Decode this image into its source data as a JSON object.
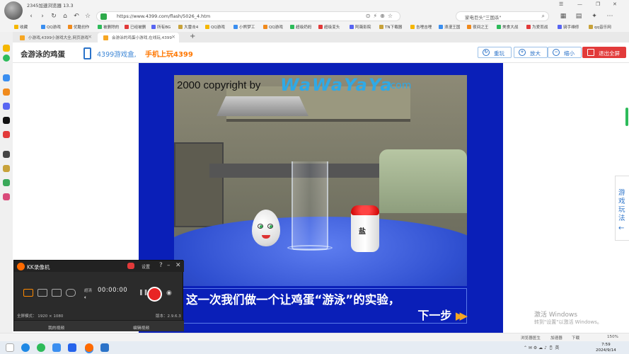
{
  "browser": {
    "window_title": "2345加速浏览器 13.3",
    "window_controls": [
      "☰",
      "—",
      "❐",
      "✕"
    ],
    "url": "https://www.4399.com/flash/5026_4.htm",
    "search_text": "家电巨头\"三国杀\"",
    "bookmarks": [
      "收藏",
      "QQ游戏",
      "优酷创作",
      "被删除的",
      "已经被删",
      "所有BG",
      "大雷击4",
      "QQ游戏",
      "小熊梦工",
      "QQ游戏",
      "超级奶妈",
      "超级变头",
      "阿薇影院",
      "TN下载器",
      "吉哩吉哩",
      "浪漫王国",
      "夜间之王",
      "美食大战",
      "为爱而战",
      "骑手维修",
      "qq音乐网"
    ],
    "tabs": [
      {
        "label": "小游戏,4399小游戏大全,网页游戏",
        "active": false
      },
      {
        "label": "会游泳的鸡蛋小游戏,在线玩,4399",
        "active": true
      }
    ]
  },
  "page": {
    "game_title": "会游泳的鸡蛋",
    "promo_text": "4399游戏盒,",
    "promo_slogan": "手机上玩4399",
    "buttons": {
      "replay": "重玩",
      "zoom_in": "放大",
      "zoom_out": "缩小",
      "exit_fullscreen": "退出全屏"
    },
    "side_tab": "游戏玩法"
  },
  "game": {
    "copyright": "2000 copyright by",
    "logo": "WaWaYaYa",
    "logo_suffix": ".com",
    "salt_label": "盐",
    "subtitle": "这一次我们做一个让鸡蛋“游泳”的实验，",
    "next_label": "下一步"
  },
  "recorder": {
    "name": "KK录像机",
    "settings": "设置",
    "quality": "超清",
    "timer": "00:00:00",
    "mode_label": "全屏模式： 1920 × 1080",
    "version": "版本：2.9.6.3",
    "my_videos": "我的视频",
    "edit_video": "编辑视频"
  },
  "watermark": {
    "line1": "激活 Windows",
    "line2": "转到\"设置\"以激活 Windows。"
  },
  "statusbar": {
    "items": [
      "浏览器医生",
      "加速器",
      "下载",
      "150%"
    ]
  },
  "taskbar": {
    "time": "7:59",
    "date": "2024/9/14"
  },
  "colors": {
    "stage_blue": "#0a1fb8",
    "accent_blue": "#2b73c9",
    "exit_red": "#e23a3a",
    "promo_orange": "#ff7700"
  }
}
